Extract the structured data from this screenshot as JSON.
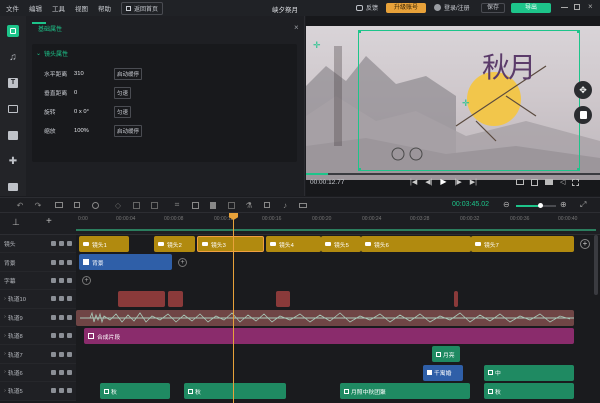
{
  "titlebar": {
    "menus": [
      "文件",
      "编辑",
      "工具",
      "视图",
      "帮助"
    ],
    "home_button": "返回首页",
    "title": "峡夕祭月",
    "feedback": "反馈",
    "upgrade": "升级账号",
    "login": "登录/注册",
    "save": "保存",
    "export": "导出"
  },
  "props": {
    "tab_label": "基础属性",
    "section_label": "镜头属性",
    "rows": [
      {
        "label": "水平距离",
        "value": "310",
        "button": "启动缓停"
      },
      {
        "label": "垂直距离",
        "value": "0",
        "button": "匀速"
      },
      {
        "label": "旋转",
        "value": "0 x 0°",
        "button": "匀速"
      },
      {
        "label": "缩放",
        "value": "100%",
        "button": "启动缓停"
      }
    ]
  },
  "preview": {
    "calligraphy": "秋月",
    "timecode": "00:00:12.77"
  },
  "toolbar": {
    "timecode": "00:03:45.02"
  },
  "ruler": {
    "ticks": [
      "0:00",
      "00:00:04",
      "00:00:08",
      "00:00:12",
      "00:00:16",
      "00:00:20",
      "00:00:24",
      "00:03:28",
      "00:00:32",
      "00:00:36",
      "00:00:40"
    ]
  },
  "tracks": [
    {
      "name": "镜头"
    },
    {
      "name": "背景"
    },
    {
      "name": "字幕"
    },
    {
      "name": "轨道10"
    },
    {
      "name": "轨道9"
    },
    {
      "name": "轨道8"
    },
    {
      "name": "轨道7"
    },
    {
      "name": "轨道6"
    },
    {
      "name": "轨道5"
    }
  ],
  "clips": {
    "lens1": "镜头1",
    "lens2": "镜头2",
    "lens3": "镜头3",
    "lens4": "镜头4",
    "lens5": "镜头5",
    "lens6": "镜头6",
    "lens7": "镜头7",
    "bg": "背景",
    "composite": "合成片段",
    "t7": "月亮",
    "t6a": "千寓婚",
    "t6b": "中",
    "t5a": "秋",
    "t5b": "秋",
    "t5c": "月照中秋团聚",
    "t5d": "秋"
  },
  "colors": {
    "accent": "#1dc48a",
    "lens": "#b18a0f",
    "selected": "#e08a2a",
    "bg_clip": "#2f5fa8",
    "audio": "#8a3a3a",
    "composite": "#8a2c6c",
    "text_clip": "#1f8a62"
  }
}
